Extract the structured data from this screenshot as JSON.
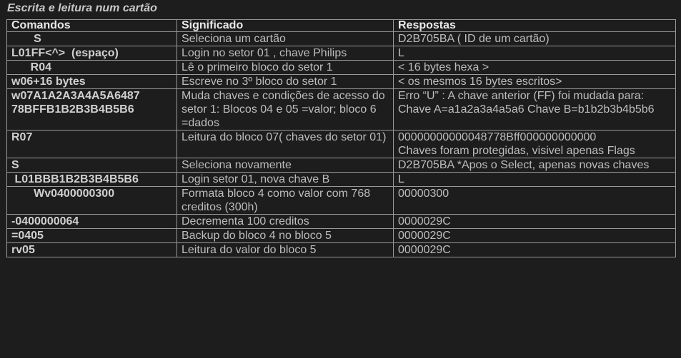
{
  "title": "Escrita e leitura num cartão",
  "headers": {
    "commands": "Comandos",
    "meaning": "Significado",
    "responses": "Respostas"
  },
  "rows": [
    {
      "command": "       S",
      "meaning": "Seleciona um cartão",
      "response": "D2B705BA ( ID de um cartão)"
    },
    {
      "command": "L01FF<^>  (espaço)",
      "meaning": "Login no setor 01 , chave Philips",
      "response": "L"
    },
    {
      "command": "      R04",
      "meaning": "Lê o primeiro bloco do setor 1",
      "response": "< 16 bytes hexa >"
    },
    {
      "command": "w06+16 bytes",
      "meaning": "Escreve no 3º bloco do setor 1",
      "response": "< os mesmos 16 bytes escritos>"
    },
    {
      "command": "w07A1A2A3A4A5A6487\n78BFFB1B2B3B4B5B6",
      "meaning": "Muda chaves e condições de acesso do setor 1: Blocos 04 e 05 =valor; bloco 6 =dados",
      "response": "Erro “U” : A chave anterior (FF) foi mudada para:\nChave A=a1a2a3a4a5a6 Chave B=b1b2b3b4b5b6"
    },
    {
      "command": "R07",
      "meaning": "Leitura do bloco 07( chaves do setor 01)",
      "response": "00000000000048778Bff000000000000\nChaves foram protegidas, visivel apenas Flags"
    },
    {
      "command": "S",
      "meaning": "Seleciona novamente",
      "response": "D2B705BA *Apos o Select, apenas novas chaves"
    },
    {
      "command": " L01BBB1B2B3B4B5B6",
      "meaning": "Login setor 01, nova chave B",
      "response": "L"
    },
    {
      "command": "       Wv0400000300",
      "meaning": "Formata bloco 4 como valor com 768 creditos (300h)",
      "response": "00000300"
    },
    {
      "command": "-0400000064",
      "meaning": "Decrementa 100 creditos",
      "response": "0000029C"
    },
    {
      "command": "=0405",
      "meaning": "Backup do bloco 4 no bloco 5",
      "response": "0000029C"
    },
    {
      "command": "rv05",
      "meaning": "Leitura do valor do bloco 5",
      "response": "0000029C"
    }
  ]
}
